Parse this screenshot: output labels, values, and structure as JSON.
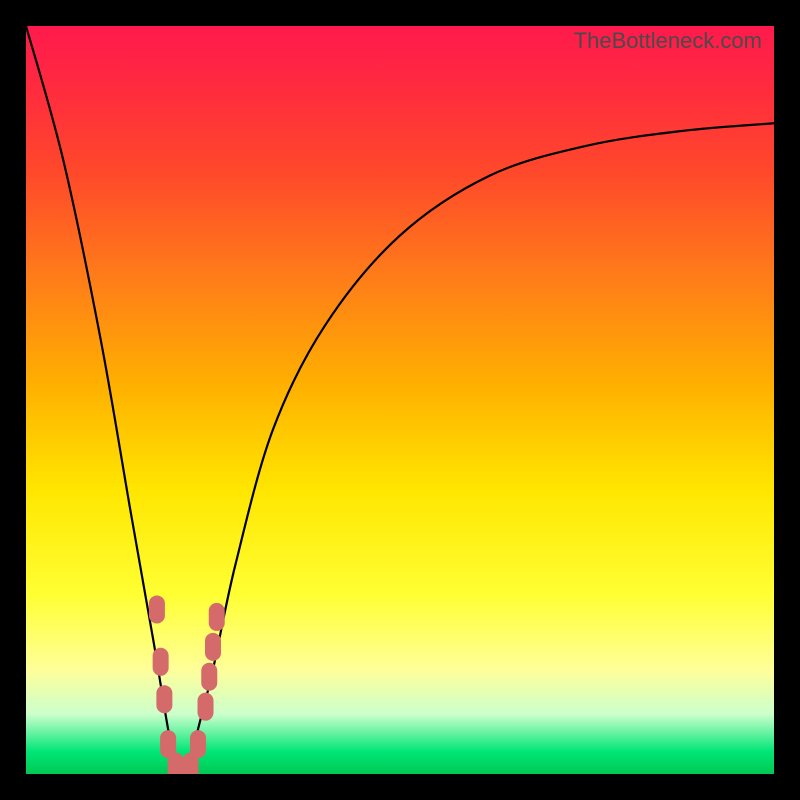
{
  "watermark": "TheBottleneck.com",
  "chart_data": {
    "type": "line",
    "title": "",
    "xlabel": "",
    "ylabel": "",
    "xlim": [
      0,
      100
    ],
    "ylim": [
      0,
      100
    ],
    "x_optimum_pct": 21,
    "series": [
      {
        "name": "bottleneck-curve",
        "x": [
          0,
          5,
          10,
          14,
          17,
          19,
          20,
          21,
          22,
          23,
          25,
          28,
          33,
          40,
          50,
          62,
          75,
          88,
          100
        ],
        "y": [
          100,
          82,
          58,
          35,
          18,
          6,
          2,
          0,
          2,
          6,
          14,
          28,
          46,
          60,
          72,
          80,
          84,
          86,
          87
        ]
      }
    ],
    "markers": {
      "name": "highlighted-points",
      "color": "#d46a6a",
      "points": [
        {
          "x": 17.5,
          "y": 22
        },
        {
          "x": 18.0,
          "y": 15
        },
        {
          "x": 18.5,
          "y": 10
        },
        {
          "x": 19.0,
          "y": 4
        },
        {
          "x": 20.0,
          "y": 1
        },
        {
          "x": 21.0,
          "y": 0
        },
        {
          "x": 22.0,
          "y": 1
        },
        {
          "x": 23.0,
          "y": 4
        },
        {
          "x": 24.0,
          "y": 9
        },
        {
          "x": 24.5,
          "y": 13
        },
        {
          "x": 25.0,
          "y": 17
        },
        {
          "x": 25.5,
          "y": 21
        }
      ]
    },
    "background_gradient": {
      "top": "#ff1a4d",
      "mid": "#ffe600",
      "bottom": "#00c853"
    }
  }
}
